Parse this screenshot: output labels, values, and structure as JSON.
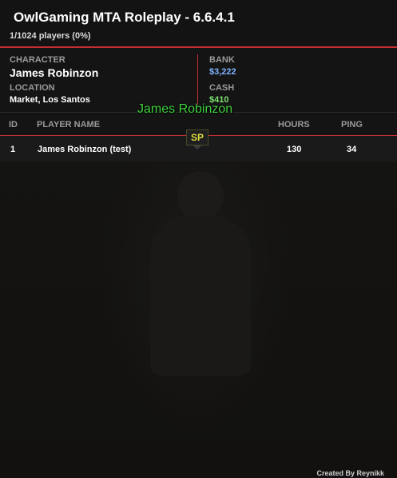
{
  "header": {
    "title": "OwlGaming MTA Roleplay - 6.6.4.1",
    "subtitle": "1/1024 players (0%)"
  },
  "info": {
    "character_label": "CHARACTER",
    "character_value": "James Robinzon",
    "location_label": "LOCATION",
    "location_value": "Market, Los Santos",
    "bank_label": "BANK",
    "bank_value": "$3,222",
    "cash_label": "CASH",
    "cash_value": "$410"
  },
  "table": {
    "columns": [
      "ID",
      "PLAYER NAME",
      "HOURS",
      "PING"
    ],
    "rows": [
      {
        "id": "1",
        "name": "James Robinzon (test)",
        "hours": "130",
        "ping": "34"
      }
    ]
  },
  "nametag": {
    "name": "James Robinzon",
    "badge": "SP"
  },
  "footer": {
    "credit": "Created By Reynikk"
  },
  "colors": {
    "accent": "#c62f35",
    "bank": "#7fb3ff",
    "cash": "#7be36e",
    "nametag": "#3fd13f"
  }
}
